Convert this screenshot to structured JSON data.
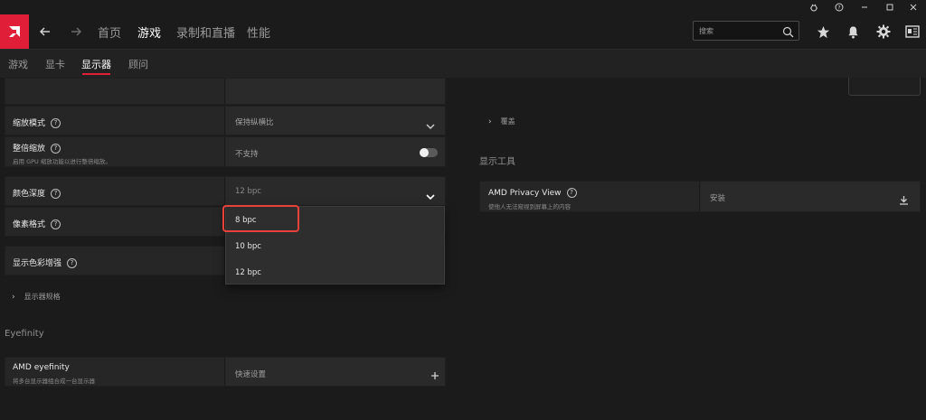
{
  "top_nav": {
    "tabs": [
      "首页",
      "游戏",
      "录制和直播",
      "性能"
    ],
    "active_tab": "游戏"
  },
  "search": {
    "placeholder": "搜索"
  },
  "sub_nav": {
    "tabs": [
      "游戏",
      "显卡",
      "显示器",
      "顾问"
    ],
    "active_tab": "显示器"
  },
  "left_panel": {
    "scaling_mode": {
      "label": "缩放模式",
      "value": "保持纵横比"
    },
    "integer_scaling": {
      "label": "整倍缩放",
      "description": "启用 GPU 缩放功能以进行整倍缩放。",
      "value": "不支持"
    },
    "color_depth": {
      "label": "颜色深度",
      "value": "12 bpc"
    },
    "pixel_format": {
      "label": "像素格式"
    },
    "display_color_enhancement": {
      "label": "显示色彩增强"
    },
    "display_specs": {
      "label": "显示器规格"
    }
  },
  "dropdown": {
    "options": [
      "8 bpc",
      "10 bpc",
      "12 bpc"
    ]
  },
  "eyefinity": {
    "section_title": "Eyefinity",
    "label": "AMD eyefinity",
    "description": "将多台显示器组合成一台显示器",
    "value": "快速设置"
  },
  "right_panel": {
    "overlay": {
      "label": "覆盖"
    },
    "tools_title": "显示工具",
    "privacy_view": {
      "label": "AMD Privacy View",
      "description": "使他人无法窥视到屏幕上的内容",
      "value": "安装"
    }
  },
  "colors": {
    "accent": "#e01e38",
    "highlight": "#e8413a"
  }
}
